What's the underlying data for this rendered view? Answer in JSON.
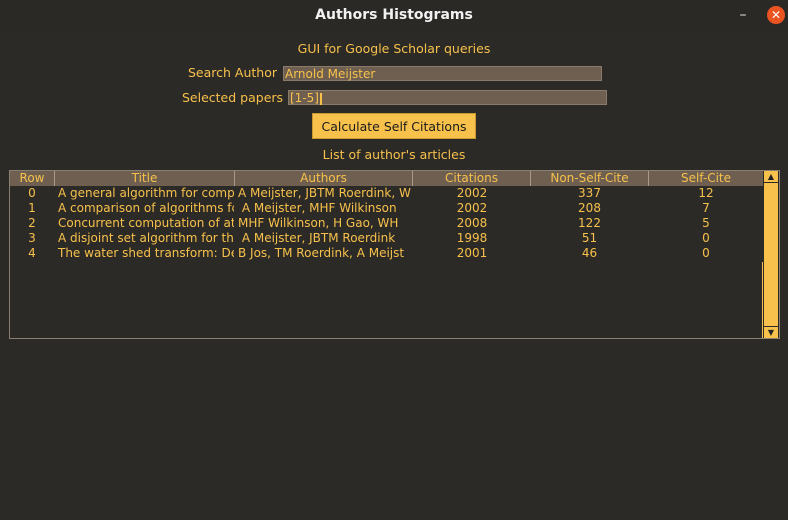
{
  "window": {
    "title": "Authors Histograms",
    "minimize_icon": "minimize-icon",
    "close_icon": "close-icon"
  },
  "form": {
    "subtitle": "GUI for Google Scholar queries",
    "search_author_label": "Search Author",
    "search_author_value": "Arnold Meijster",
    "selected_papers_label": "Selected papers",
    "selected_papers_value": "[1-5]",
    "calculate_button": "Calculate Self Citations",
    "list_caption": "List of author's articles"
  },
  "table": {
    "columns": [
      "Row",
      "Title",
      "Authors",
      "Citations",
      "Non-Self-Cite",
      "Self-Cite"
    ],
    "rows": [
      {
        "row": "0",
        "title": "A general algorithm for compu",
        "authors": "A Meijster, JBTM Roerdink, W",
        "citations": "2002",
        "non_self": "337",
        "self": "12"
      },
      {
        "row": "1",
        "title": "A comparison of algorithms fc",
        "authors": " A Meijster, MHF Wilkinson",
        "citations": "2002",
        "non_self": "208",
        "self": "7"
      },
      {
        "row": "2",
        "title": "Concurrent computation of att",
        "authors": "MHF Wilkinson, H Gao, WH",
        "citations": "2008",
        "non_self": "122",
        "self": "5"
      },
      {
        "row": "3",
        "title": "A disjoint set algorithm for the",
        "authors": " A Meijster, JBTM Roerdink",
        "citations": "1998",
        "non_self": "51",
        "self": "0"
      },
      {
        "row": "4",
        "title": "The water shed transform: De",
        "authors": "B Jos, TM Roerdink, A Meijst",
        "citations": "2001",
        "non_self": "46",
        "self": "0"
      }
    ]
  },
  "colors": {
    "accent": "#f7c14b",
    "background": "#2c2a27",
    "field": "#6f5f50",
    "close": "#e95420"
  }
}
